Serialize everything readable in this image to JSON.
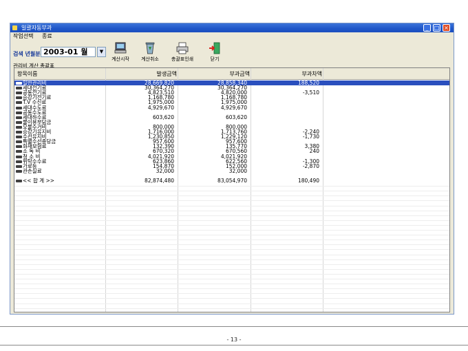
{
  "window": {
    "title": "일괄자동부과"
  },
  "menu": [
    "작업선택",
    "종료"
  ],
  "toolbar": {
    "month_label": "검색 년월분",
    "month_value": "2003-01 월",
    "buttons": [
      {
        "label": "계산시작",
        "icon": "computer-icon"
      },
      {
        "label": "계산취소",
        "icon": "recycle-bin-icon"
      },
      {
        "label": "총괄표인쇄",
        "icon": "printer-icon"
      },
      {
        "label": "닫기",
        "icon": "exit-door-icon"
      }
    ]
  },
  "group_label": "관리비 계산 총괄표",
  "table": {
    "columns": [
      "항목이름",
      "발생금액",
      "부과금액",
      "부과차액"
    ],
    "rows": [
      [
        "일반관리비",
        "28,669,820",
        "28,858,340",
        "188,520"
      ],
      [
        "세대전기료",
        "30,364,270",
        "30,364,270",
        ""
      ],
      [
        "공동전기료",
        "4,823,510",
        "4,820,000",
        "-3,510"
      ],
      [
        "승강기전기료",
        "1,168,780",
        "1,168,780",
        ""
      ],
      [
        "T.V 수신료",
        "1,975,000",
        "1,975,000",
        ""
      ],
      [
        "세대수도료",
        "4,929,670",
        "4,929,670",
        ""
      ],
      [
        "공동수도료",
        "",
        "",
        ""
      ],
      [
        "세대하수료",
        "603,620",
        "603,620",
        ""
      ],
      [
        "물이용부담금",
        "",
        "",
        ""
      ],
      [
        "오물수거비",
        "800,000",
        "800,000",
        ""
      ],
      [
        "승강기유지비",
        "1,716,000",
        "1,713,760",
        "-2,240"
      ],
      [
        "수선유지비",
        "1,230,850",
        "1,229,120",
        "-1,730"
      ],
      [
        "특별수선충당금",
        "957,600",
        "957,600",
        ""
      ],
      [
        "화재보험료",
        "132,390",
        "135,770",
        "3,380"
      ],
      [
        "소 독 비",
        "670,320",
        "670,560",
        "240"
      ],
      [
        "청 소 비",
        "4,021,920",
        "4,021,920",
        ""
      ],
      [
        "위탁수수료",
        "623,860",
        "622,560",
        "-1,300"
      ],
      [
        "가로등",
        "154,870",
        "152,000",
        "-2,870"
      ],
      [
        "관손실료",
        "32,000",
        "32,000",
        ""
      ],
      [
        "",
        "",
        "",
        ""
      ],
      [
        "<< 합 계 >>",
        "82,874,480",
        "83,054,970",
        "180,490"
      ]
    ],
    "selected_row": 0
  },
  "page_number": "- 13 -",
  "colors": {
    "selection": "#2a4fbe",
    "titlebar": "#1f56c8"
  }
}
